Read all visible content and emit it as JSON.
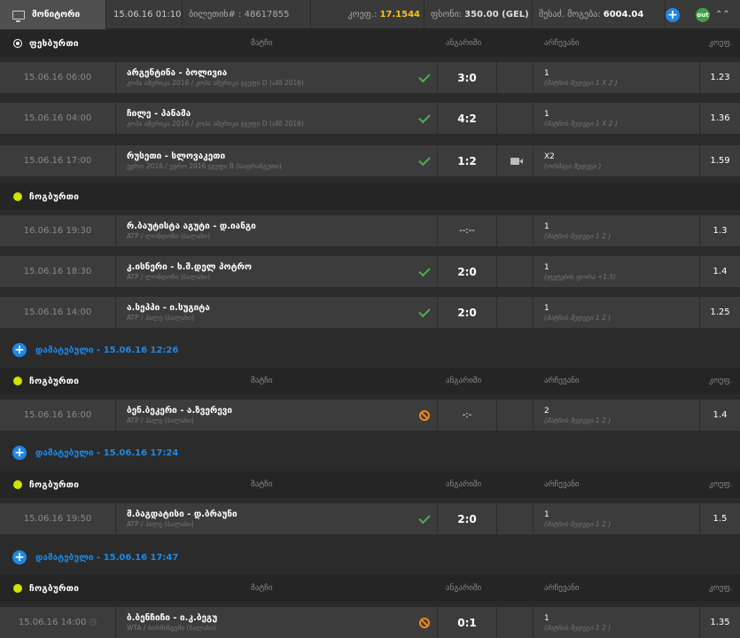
{
  "topbar": {
    "title": "მონიტორი",
    "datetime": "15.06.16 01:10",
    "ticket": "ბილეთიხ# : 48617855",
    "coef_label": "კოეფ.:",
    "coef_value": "17.1544",
    "stake_label": "ფსონი:",
    "stake_value": "350.00 (GEL)",
    "win_label": "შესაძ. მოგება:",
    "win_value": "6004.04",
    "plus_button": "+",
    "out_button": "out",
    "collapse": "⌃⌃"
  },
  "columns": {
    "match": "მატჩი",
    "result": "ანგარიში",
    "choice": "არჩევანი",
    "coef": "კოეფ."
  },
  "sections": [
    {
      "title": "ფეხბურთი",
      "sport": "soccer",
      "show_columns": true
    },
    {
      "title": "ჩოგბურთი",
      "sport": "tennis",
      "show_columns": false
    },
    {
      "title": "ჩოგბურთი",
      "sport": "tennis",
      "show_columns": true
    },
    {
      "title": "ჩოგბურთი",
      "sport": "tennis",
      "show_columns": true
    },
    {
      "title": "ჩოგბურთი",
      "sport": "tennis",
      "show_columns": true
    }
  ],
  "added": [
    {
      "label": "დამატებული - 15.06.16 12:26"
    },
    {
      "label": "დამატებული - 15.06.16 17:24"
    },
    {
      "label": "დამატებული - 15.06.16 17:47"
    }
  ],
  "rows": [
    {
      "date": "15.06.16 06:00",
      "name": "არგენტინა - ბოლივია",
      "sub": "კოპა ამერიკა 2016 / კოპა ამერიკა ჯგუფი D (აშშ 2016)",
      "status": "won",
      "score": "3:0",
      "video": false,
      "pick": "1",
      "pick_sub": "(მატჩის შედეგი 1 X 2 )",
      "coef": "1.23",
      "clock": false
    },
    {
      "date": "15.06.16 04:00",
      "name": "ჩილე - პანამა",
      "sub": "კოპა ამერიკა 2016 / კოპა ამერიკა ჯგუფი D (აშშ 2016)",
      "status": "won",
      "score": "4:2",
      "video": false,
      "pick": "1",
      "pick_sub": "(მატჩის შედეგი 1 X 2 )",
      "coef": "1.36",
      "clock": false
    },
    {
      "date": "15.06.16 17:00",
      "name": "რუსეთი - სლოვაკეთი",
      "sub": "ევრო 2016 / ევრო 2016 ჯგუფი B (საფრანგეთი)",
      "status": "won",
      "score": "1:2",
      "video": true,
      "pick": "X2",
      "pick_sub": "(ორმაგი შედეგი )",
      "coef": "1.59",
      "clock": false
    },
    {
      "date": "16.06.16 19:30",
      "name": "რ.ბაუტისტა აგუტი - დ.იანგი",
      "sub": "ATP / ლონდონი (ბალახი)",
      "status": "none",
      "score": "--:--",
      "video": false,
      "pick": "1",
      "pick_sub": "(მატჩის შედეგი 1 2 )",
      "coef": "1.3",
      "clock": false
    },
    {
      "date": "15.06.16 18:30",
      "name": "კ.ისნერი - ხ.მ.დელ პოტრო",
      "sub": "ATP / ლონდონი (ბალახი)",
      "status": "won",
      "score": "2:0",
      "video": false,
      "pick": "1",
      "pick_sub": "(ფეტების ფორა +1.5)",
      "coef": "1.4",
      "clock": false
    },
    {
      "date": "15.06.16 14:00",
      "name": "ა.სეპპი - ი.სუგიტა",
      "sub": "ATP / ჰალე (ბალახი)",
      "status": "won",
      "score": "2:0",
      "video": false,
      "pick": "1",
      "pick_sub": "(მატჩის შედეგი 1 2 )",
      "coef": "1.25",
      "clock": false
    },
    {
      "date": "15.06.16 16:00",
      "name": "ბენ.ბეკერი - ა.ზვერევი",
      "sub": "ATP / ჰალე (ბალახი)",
      "status": "cancel",
      "score": "-:-",
      "video": false,
      "pick": "2",
      "pick_sub": "(მატჩის შედეგი 1 2 )",
      "coef": "1.4",
      "clock": false
    },
    {
      "date": "15.06.16 19:50",
      "name": "მ.ბაგდატისი - დ.ბრაუნი",
      "sub": "ATP / ჰალე (ბალახი)",
      "status": "won",
      "score": "2:0",
      "video": false,
      "pick": "1",
      "pick_sub": "(მატჩის შედეგი 1 2 )",
      "coef": "1.5",
      "clock": false
    },
    {
      "date": "15.06.16 14:00",
      "name": "ბ.ბენჩიჩი - ი.კ.ბეგუ",
      "sub": "WTA / ბირმინგემი (ბალახი)",
      "status": "cancel",
      "score": "0:1",
      "video": false,
      "pick": "1",
      "pick_sub": "(მატჩის შედეგი 1 2 )",
      "coef": "1.35",
      "clock": true
    }
  ]
}
